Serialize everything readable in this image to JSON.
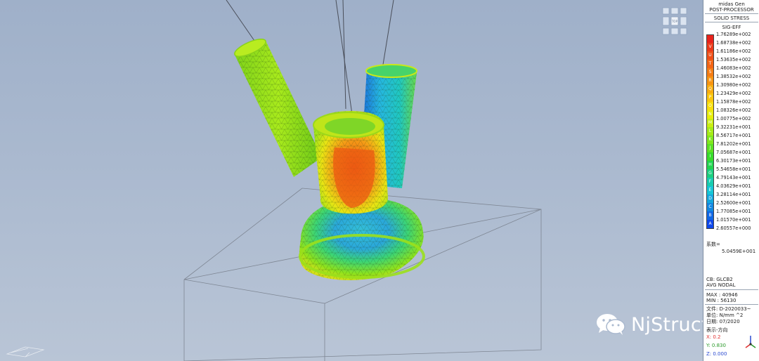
{
  "panel": {
    "app_title": "midas Gen",
    "module": "POST-PROCESSOR",
    "result_type": "SOLID STRESS",
    "component": "SIG-EFF",
    "legend": [
      {
        "value": "1.76289e+002",
        "letter": "",
        "color": "#e8231c"
      },
      {
        "value": "1.68738e+002",
        "letter": "V",
        "color": "#ec3a1a"
      },
      {
        "value": "1.61186e+002",
        "letter": "U",
        "color": "#f04f18"
      },
      {
        "value": "1.53635e+002",
        "letter": "T",
        "color": "#f46616"
      },
      {
        "value": "1.46083e+002",
        "letter": "S",
        "color": "#f67d14"
      },
      {
        "value": "1.38532e+002",
        "letter": "R",
        "color": "#f89512"
      },
      {
        "value": "1.30980e+002",
        "letter": "Q",
        "color": "#faae10"
      },
      {
        "value": "1.23429e+002",
        "letter": "P",
        "color": "#fcc70e"
      },
      {
        "value": "1.15878e+002",
        "letter": "O",
        "color": "#f9df0c"
      },
      {
        "value": "1.08326e+002",
        "letter": "N",
        "color": "#e8ee0c"
      },
      {
        "value": "1.00775e+002",
        "letter": "M",
        "color": "#c9ef12"
      },
      {
        "value": "9.32231e+001",
        "letter": "L",
        "color": "#a6ec18"
      },
      {
        "value": "8.56717e+001",
        "letter": "K",
        "color": "#81e81e"
      },
      {
        "value": "7.81202e+001",
        "letter": "J",
        "color": "#5ce224"
      },
      {
        "value": "7.05687e+001",
        "letter": "I",
        "color": "#38dc2c"
      },
      {
        "value": "6.30173e+001",
        "letter": "H",
        "color": "#22d550"
      },
      {
        "value": "5.54658e+001",
        "letter": "G",
        "color": "#1cd080"
      },
      {
        "value": "4.79143e+001",
        "letter": "F",
        "color": "#19cdb0"
      },
      {
        "value": "4.03629e+001",
        "letter": "E",
        "color": "#16c6d6"
      },
      {
        "value": "3.28114e+001",
        "letter": "D",
        "color": "#14a8de"
      },
      {
        "value": "2.52600e+001",
        "letter": "C",
        "color": "#1288e2"
      },
      {
        "value": "1.77085e+001",
        "letter": "B",
        "color": "#1068e6"
      },
      {
        "value": "1.01570e+001",
        "letter": "A",
        "color": "#0e48ea"
      }
    ],
    "legend_min": "2.60557e+000",
    "factor_label": "系数=",
    "factor_value": "5.0459E+001",
    "cb_label": "CB: GLCB2",
    "nodal_label": "AVG NODAL",
    "max_label": "MAX : 40946",
    "min_label": "MIN : 56130",
    "file_label": "文件: D-2020033~",
    "unit_label": "单位: N/mm ^2",
    "date_label": "日期: 07/2020",
    "view_label": "表示-方向",
    "x_label": "X: 0.2",
    "y_label": "Y: 0.830",
    "z_label": "Z: 0.000"
  },
  "viewport": {
    "viewcube_label": "TOP",
    "watermark": "NjStructure"
  }
}
